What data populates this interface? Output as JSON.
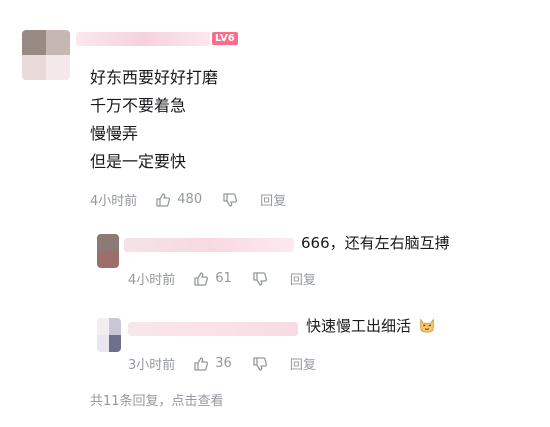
{
  "comment": {
    "level_badge": "LV6",
    "lines": [
      "好东西要好好打磨",
      "千万不要着急",
      "慢慢弄",
      "但是一定要快"
    ],
    "time": "4小时前",
    "likes": "480",
    "reply_label": "回复"
  },
  "replies": [
    {
      "text": "666，还有左右脑互搏",
      "time": "4小时前",
      "likes": "61",
      "reply_label": "回复"
    },
    {
      "text": "快速慢工出细活",
      "time": "3小时前",
      "likes": "36",
      "reply_label": "回复"
    }
  ],
  "footer": {
    "text": "共11条回复，点击查看"
  },
  "colors": {
    "meta_gray": "#9499a0",
    "level_badge": "#ff6b8a"
  },
  "icons": [
    "thumbs-up-icon",
    "thumbs-down-icon",
    "cat-emoji-icon"
  ]
}
